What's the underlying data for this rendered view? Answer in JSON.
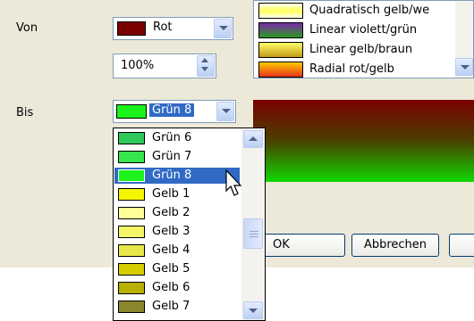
{
  "labels": {
    "von": "Von",
    "bis": "Bis"
  },
  "von": {
    "color_label": "Rot",
    "swatch": "#7a0000",
    "transparency": "100%"
  },
  "bis": {
    "color_label": "Grün 8",
    "swatch": "#1bf21b"
  },
  "gradients": [
    {
      "label": "Quadratisch gelb/we",
      "icon": "gradient-yellow-white-swatch"
    },
    {
      "label": "Linear violett/grün",
      "icon": "gradient-violet-green-swatch"
    },
    {
      "label": "Linear gelb/braun",
      "icon": "gradient-yellow-brown-swatch"
    },
    {
      "label": "Radial rot/gelb",
      "icon": "gradient-red-yellow-swatch"
    }
  ],
  "color_list": [
    {
      "label": "Grün 6",
      "color": "#2fc85a"
    },
    {
      "label": "Grün 7",
      "color": "#36e64c"
    },
    {
      "label": "Grün 8",
      "color": "#1bf21b",
      "selected": true
    },
    {
      "label": "Gelb 1",
      "color": "#f5f500"
    },
    {
      "label": "Gelb 2",
      "color": "#ffff99"
    },
    {
      "label": "Gelb 3",
      "color": "#f5f56a"
    },
    {
      "label": "Gelb 4",
      "color": "#e8e84a"
    },
    {
      "label": "Gelb 5",
      "color": "#d6cc00"
    },
    {
      "label": "Gelb 6",
      "color": "#b8b000"
    },
    {
      "label": "Gelb 7",
      "color": "#8a8630"
    }
  ],
  "buttons": {
    "ok": "OK",
    "cancel": "Abbrechen"
  },
  "colors": {
    "panel": "#ece9d8",
    "selection": "#316ac5",
    "field_border": "#7f9db9"
  }
}
